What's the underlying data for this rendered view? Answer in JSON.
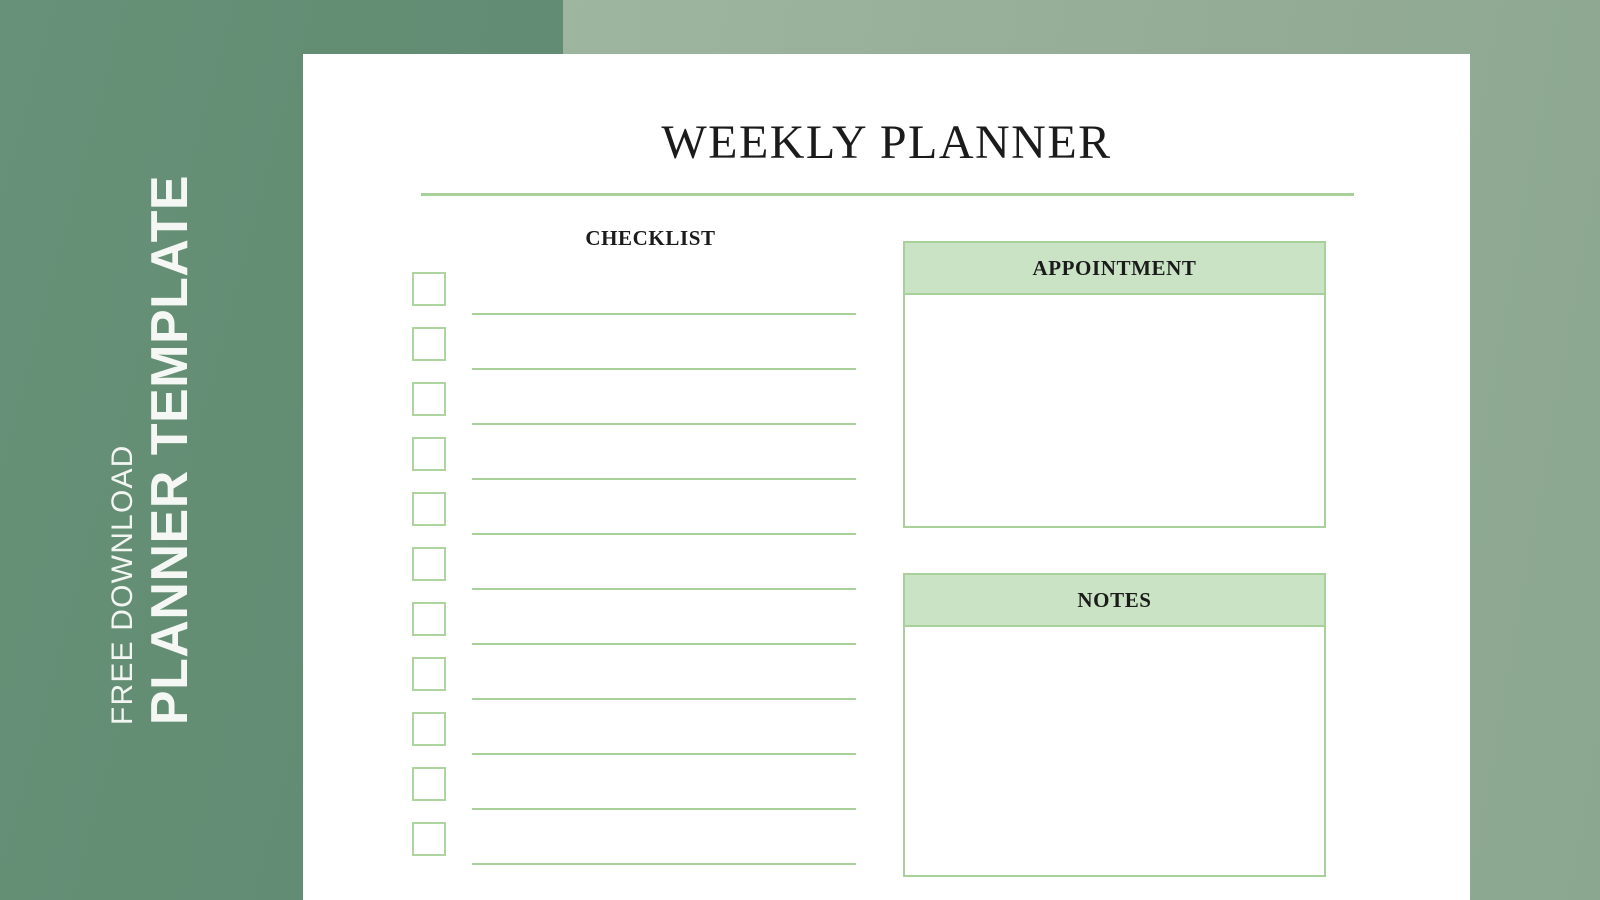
{
  "document": {
    "title": "WEEKLY PLANNER"
  },
  "promo": {
    "subtitle": "FREE DOWNLOAD",
    "title": "PLANNER TEMPLATE"
  },
  "checklist": {
    "heading": "CHECKLIST",
    "rows": [
      {
        "checked": false,
        "text": ""
      },
      {
        "checked": false,
        "text": ""
      },
      {
        "checked": false,
        "text": ""
      },
      {
        "checked": false,
        "text": ""
      },
      {
        "checked": false,
        "text": ""
      },
      {
        "checked": false,
        "text": ""
      },
      {
        "checked": false,
        "text": ""
      },
      {
        "checked": false,
        "text": ""
      },
      {
        "checked": false,
        "text": ""
      },
      {
        "checked": false,
        "text": ""
      },
      {
        "checked": false,
        "text": ""
      }
    ]
  },
  "panels": [
    {
      "heading": "APPOINTMENT",
      "content": ""
    },
    {
      "heading": "NOTES",
      "content": ""
    }
  ],
  "colors": {
    "background_left": "#669077",
    "background_right": "#9cb49e",
    "page": "#ffffff",
    "accent_line": "#a8d09a",
    "panel_header_fill": "#c9e3c4",
    "text": "#1b1b1b",
    "promo_text": "#f2f5f1"
  }
}
